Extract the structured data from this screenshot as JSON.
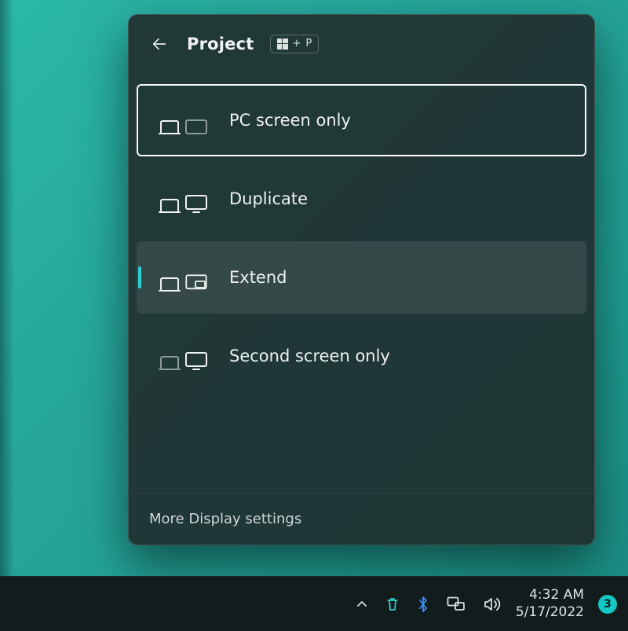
{
  "flyout": {
    "title": "Project",
    "shortcut": {
      "modifier_glyph": "windows",
      "plus": "+",
      "key": "P"
    },
    "options": [
      {
        "id": "pc-only",
        "label": "PC screen only",
        "state": "focused"
      },
      {
        "id": "duplicate",
        "label": "Duplicate",
        "state": "normal"
      },
      {
        "id": "extend",
        "label": "Extend",
        "state": "hovered"
      },
      {
        "id": "second-only",
        "label": "Second screen only",
        "state": "normal"
      }
    ],
    "footer_link": "More Display settings"
  },
  "taskbar": {
    "tray_overflow_icon": "chevron-up",
    "icons": [
      "recycle-bin",
      "bluetooth",
      "network",
      "volume"
    ],
    "clock": {
      "time": "4:32 AM",
      "date": "5/17/2022"
    },
    "notification_count": "3"
  },
  "colors": {
    "accent": "#2bd4d0",
    "panel_bg": "rgba(32,50,48,.95)",
    "taskbar_bg": "#121c1c"
  }
}
